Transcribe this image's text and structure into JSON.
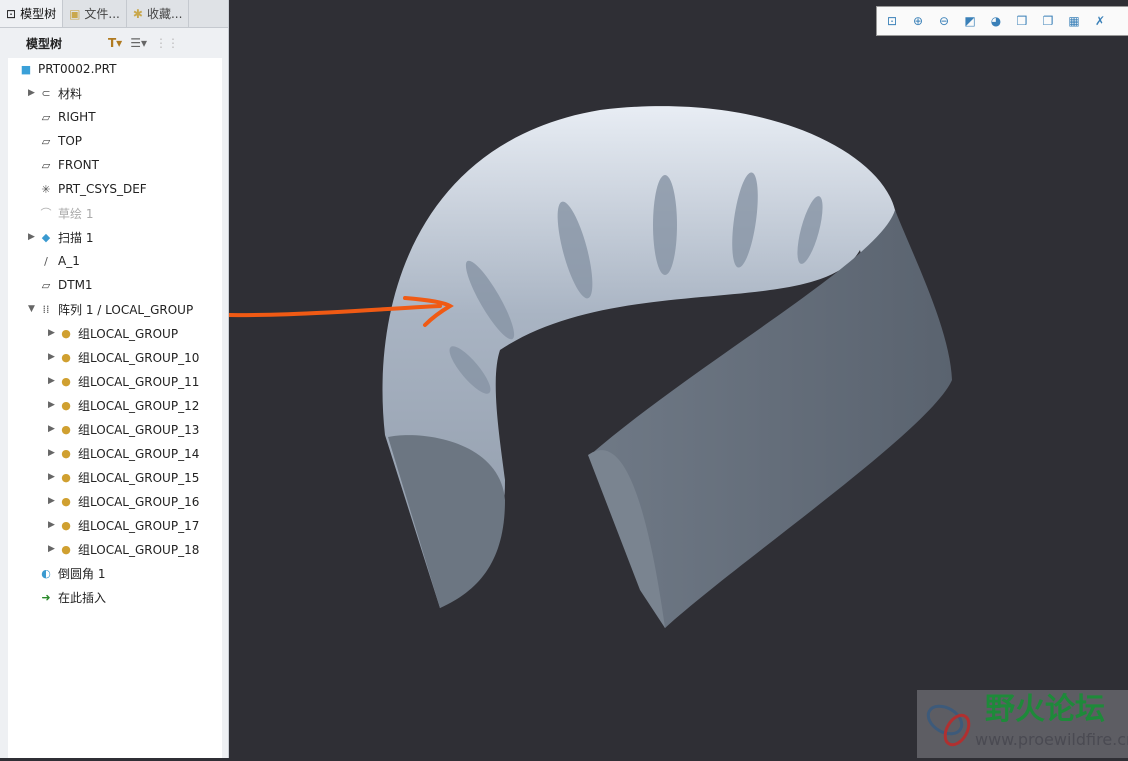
{
  "tabs": [
    {
      "label": "模型树",
      "icon": "tree-icon"
    },
    {
      "label": "文件...",
      "icon": "folder-files-icon"
    },
    {
      "label": "收藏...",
      "icon": "favorites-icon"
    }
  ],
  "toolbar": {
    "title": "模型树"
  },
  "tree": [
    {
      "label": "PRT0002.PRT",
      "icon": "part-icon",
      "indent": 0,
      "expander": ""
    },
    {
      "label": "材料",
      "icon": "material-icon",
      "indent": 1,
      "expander": "▶"
    },
    {
      "label": "RIGHT",
      "icon": "datum-plane-icon",
      "indent": 1,
      "expander": ""
    },
    {
      "label": "TOP",
      "icon": "datum-plane-icon",
      "indent": 1,
      "expander": ""
    },
    {
      "label": "FRONT",
      "icon": "datum-plane-icon",
      "indent": 1,
      "expander": ""
    },
    {
      "label": "PRT_CSYS_DEF",
      "icon": "csys-icon",
      "indent": 1,
      "expander": ""
    },
    {
      "label": "草绘 1",
      "icon": "sketch-icon",
      "indent": 1,
      "expander": "",
      "dim": true
    },
    {
      "label": "扫描 1",
      "icon": "sweep-icon",
      "indent": 1,
      "expander": "▶"
    },
    {
      "label": "A_1",
      "icon": "axis-icon",
      "indent": 1,
      "expander": ""
    },
    {
      "label": "DTM1",
      "icon": "datum-plane-icon",
      "indent": 1,
      "expander": ""
    },
    {
      "label": "阵列 1 / LOCAL_GROUP",
      "icon": "pattern-icon",
      "indent": 1,
      "expander": "▼"
    },
    {
      "label": "组LOCAL_GROUP",
      "icon": "group-icon",
      "indent": 2,
      "expander": "▶"
    },
    {
      "label": "组LOCAL_GROUP_10",
      "icon": "group-icon",
      "indent": 2,
      "expander": "▶"
    },
    {
      "label": "组LOCAL_GROUP_11",
      "icon": "group-icon",
      "indent": 2,
      "expander": "▶"
    },
    {
      "label": "组LOCAL_GROUP_12",
      "icon": "group-icon",
      "indent": 2,
      "expander": "▶"
    },
    {
      "label": "组LOCAL_GROUP_13",
      "icon": "group-icon",
      "indent": 2,
      "expander": "▶"
    },
    {
      "label": "组LOCAL_GROUP_14",
      "icon": "group-icon",
      "indent": 2,
      "expander": "▶"
    },
    {
      "label": "组LOCAL_GROUP_15",
      "icon": "group-icon",
      "indent": 2,
      "expander": "▶"
    },
    {
      "label": "组LOCAL_GROUP_16",
      "icon": "group-icon",
      "indent": 2,
      "expander": "▶"
    },
    {
      "label": "组LOCAL_GROUP_17",
      "icon": "group-icon",
      "indent": 2,
      "expander": "▶"
    },
    {
      "label": "组LOCAL_GROUP_18",
      "icon": "group-icon",
      "indent": 2,
      "expander": "▶"
    },
    {
      "label": "倒圆角 1",
      "icon": "round-icon",
      "indent": 1,
      "expander": ""
    },
    {
      "label": "在此插入",
      "icon": "insert-here-icon",
      "indent": 1,
      "expander": ""
    }
  ],
  "view_toolbar": [
    "refit-icon",
    "zoom-in-icon",
    "zoom-out-icon",
    "repaint-icon",
    "display-style-icon",
    "saved-views-icon",
    "view-manager-icon",
    "spin-center-icon",
    "datum-display-icon"
  ],
  "watermark": {
    "name": "野火论坛",
    "url": "www.proewildfire.cn"
  },
  "colors": {
    "viewport": "#2f2f35",
    "annotation": "#f05a14",
    "model": "#9aa6b5"
  }
}
